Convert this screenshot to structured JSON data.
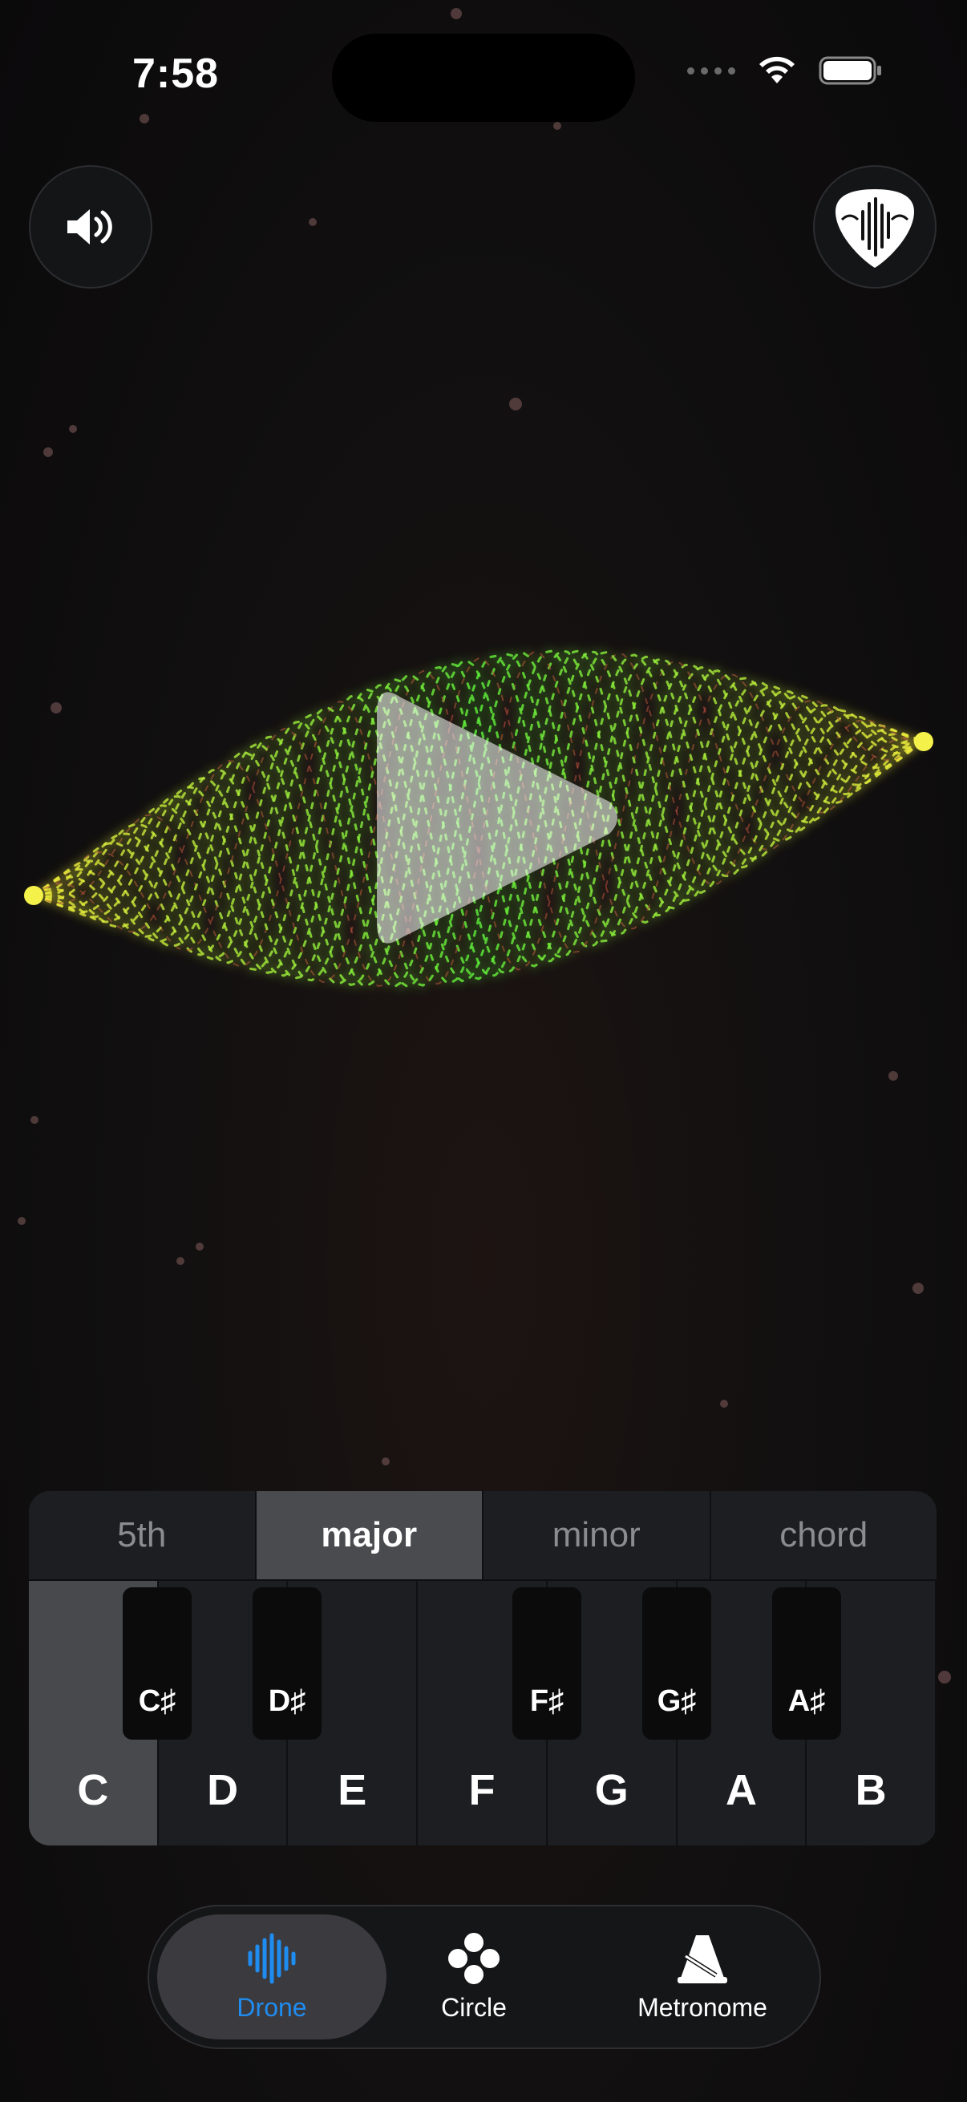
{
  "status_bar": {
    "time": "7:58"
  },
  "top_controls": {
    "volume_icon": "speaker-wave-icon",
    "app_icon": "guitar-pick-logo-icon"
  },
  "player": {
    "state": "paused",
    "play_icon": "play-icon"
  },
  "chord_modes": {
    "items": [
      {
        "label": "5th",
        "active": false
      },
      {
        "label": "major",
        "active": true
      },
      {
        "label": "minor",
        "active": false
      },
      {
        "label": "chord",
        "active": false
      }
    ]
  },
  "keyboard": {
    "white_keys": [
      {
        "label": "C",
        "active": true
      },
      {
        "label": "D",
        "active": false
      },
      {
        "label": "E",
        "active": false
      },
      {
        "label": "F",
        "active": false
      },
      {
        "label": "G",
        "active": false
      },
      {
        "label": "A",
        "active": false
      },
      {
        "label": "B",
        "active": false
      }
    ],
    "black_keys": [
      {
        "label": "C♯"
      },
      {
        "label": "D♯"
      },
      {
        "label": "F♯"
      },
      {
        "label": "G♯"
      },
      {
        "label": "A♯"
      }
    ]
  },
  "tabbar": {
    "tabs": [
      {
        "label": "Drone",
        "icon": "waveform-icon",
        "active": true
      },
      {
        "label": "Circle",
        "icon": "circle-of-fifths-icon",
        "active": false
      },
      {
        "label": "Metronome",
        "icon": "metronome-icon",
        "active": false
      }
    ]
  },
  "colors": {
    "accent": "#1f8cf0",
    "wave_green": "#58e83a",
    "wave_yellow": "#e6e43a",
    "wave_red": "#c0392b"
  }
}
